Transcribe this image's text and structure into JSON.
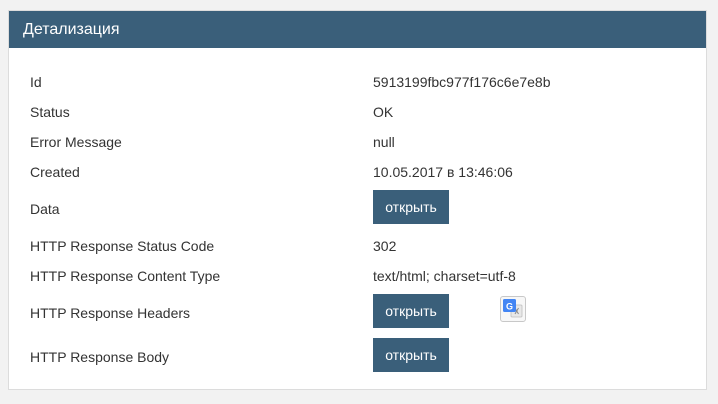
{
  "panel": {
    "title": "Детализация"
  },
  "details": {
    "id": {
      "label": "Id",
      "value": "5913199fbc977f176c6e7e8b"
    },
    "status": {
      "label": "Status",
      "value": "OK"
    },
    "error_message": {
      "label": "Error Message",
      "value": "null"
    },
    "created": {
      "label": "Created",
      "value": "10.05.2017 в 13:46:06"
    },
    "data": {
      "label": "Data",
      "button": "открыть"
    },
    "http_status_code": {
      "label": "HTTP Response Status Code",
      "value": "302"
    },
    "http_content_type": {
      "label": "HTTP Response Content Type",
      "value": "text/html; charset=utf-8"
    },
    "http_headers": {
      "label": "HTTP Response Headers",
      "button": "открыть"
    },
    "http_body": {
      "label": "HTTP Response Body",
      "button": "открыть"
    }
  },
  "icons": {
    "translate": "google-translate-icon"
  },
  "colors": {
    "header_bg": "#3a5f7a",
    "button_bg": "#3a5f7a",
    "page_bg": "#f2f2f2",
    "text": "#333333"
  }
}
